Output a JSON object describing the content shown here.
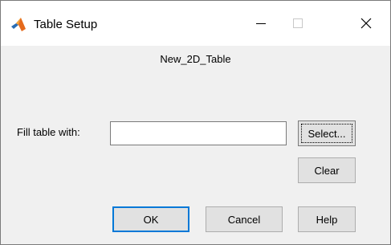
{
  "window": {
    "title": "Table Setup",
    "icon": "matlab-icon",
    "controls": {
      "minimize_icon": "minimize-icon",
      "maximize_icon": "maximize-icon",
      "close_icon": "close-icon"
    }
  },
  "dialog": {
    "table_name": "New_2D_Table",
    "fill_label": "Fill table with:",
    "fill_value": "",
    "buttons": {
      "select": "Select...",
      "clear": "Clear",
      "ok": "OK",
      "cancel": "Cancel",
      "help": "Help"
    }
  },
  "colors": {
    "titlebar": "#ffffff",
    "background": "#f0f0f0",
    "button_face": "#e1e1e1",
    "default_button_border": "#0078d7"
  }
}
